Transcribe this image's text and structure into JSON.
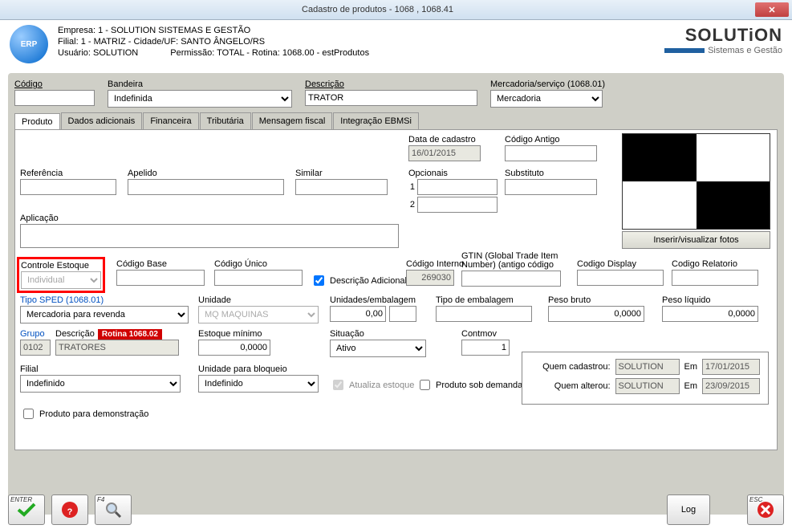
{
  "window": {
    "title": "Cadastro de produtos - 1068 , 1068.41"
  },
  "header": {
    "empresa": "Empresa: 1 - SOLUTION SISTEMAS E GESTÃO",
    "filial": "Filial: 1 - MATRIZ - Cidade/UF: SANTO ÂNGELO/RS",
    "usuario": "Usuário: SOLUTION",
    "permissao": "Permissão: TOTAL - Rotina: 1068.00 - estProdutos",
    "brand": "SOLUTiON",
    "brand_sub": "Sistemas e Gestão",
    "logo_text": "ERP"
  },
  "top_fields": {
    "codigo_lbl": "Código",
    "codigo": "",
    "bandeira_lbl": "Bandeira",
    "bandeira": "Indefinida",
    "descricao_lbl": "Descrição",
    "descricao": "TRATOR",
    "merc_lbl": "Mercadoria/serviço (1068.01)",
    "merc": "Mercadoria"
  },
  "tabs": {
    "produto": "Produto",
    "dados": "Dados adicionais",
    "financeira": "Financeira",
    "tributaria": "Tributária",
    "msg_fiscal": "Mensagem fiscal",
    "integracao": "Integração EBMSi"
  },
  "panel": {
    "data_cadastro_lbl": "Data de cadastro",
    "data_cadastro": "16/01/2015",
    "cod_antigo_lbl": "Código Antigo",
    "cod_antigo": "",
    "referencia_lbl": "Referência",
    "referencia": "",
    "apelido_lbl": "Apelido",
    "apelido": "",
    "similar_lbl": "Similar",
    "similar": "",
    "opcionais_lbl": "Opcionais",
    "opt1_n": "1",
    "opt1": "",
    "opt2_n": "2",
    "opt2": "",
    "substituto_lbl": "Substituto",
    "substituto": "",
    "aplicacao_lbl": "Aplicação",
    "aplicacao": "",
    "photo_btn": "Inserir/visualizar fotos",
    "controle_lbl": "Controle Estoque",
    "controle": "Individual",
    "cod_base_lbl": "Código Base",
    "cod_base": "",
    "cod_unico_lbl": "Código Único",
    "cod_unico": "",
    "desc_adicional_lbl": "Descrição Adicional",
    "cod_interno_lbl": "Código Interno",
    "cod_interno": "269030",
    "gtin_lbl": "GTIN (Global Trade Item Number) (antigo código",
    "gtin": "",
    "cod_display_lbl": "Codigo Display",
    "cod_display": "",
    "cod_relatorio_lbl": "Codigo Relatorio",
    "cod_relatorio": "",
    "tipo_sped_lbl": "Tipo SPED (1068.01)",
    "tipo_sped": "Mercadoria para revenda",
    "unidade_lbl": "Unidade",
    "unidade": "MQ  MAQUINAS",
    "unid_emb_lbl": "Unidades/embalagem",
    "unid_emb": "0,00",
    "unid_emb2": "",
    "tipo_emb_lbl": "Tipo de embalagem",
    "tipo_emb": "",
    "peso_bruto_lbl": "Peso bruto",
    "peso_bruto": "0,0000",
    "peso_liq_lbl": "Peso líquido",
    "peso_liq": "0,0000",
    "grupo_lbl": "Grupo",
    "grupo": "0102",
    "grupo_desc_lbl": "Descrição",
    "grupo_desc": "TRATORES",
    "rotina_badge": "Rotina 1068.02",
    "est_min_lbl": "Estoque mínimo",
    "est_min": "0,0000",
    "situacao_lbl": "Situação",
    "situacao": "Ativo",
    "contmov_lbl": "Contmov",
    "contmov": "1",
    "filial_lbl": "Filial",
    "filial": "Indefinido",
    "unid_bloq_lbl": "Unidade para bloqueio",
    "unid_bloq": "Indefinido",
    "atualiza_lbl": "Atualiza estoque",
    "sob_demanda_lbl": "Produto sob demanda",
    "demo_lbl": "Produto para demonstração",
    "audit": {
      "cad_lbl": "Quem cadastrou:",
      "cad_user": "SOLUTION",
      "cad_em": "Em",
      "cad_date": "17/01/2015",
      "alt_lbl": "Quem alterou:",
      "alt_user": "SOLUTION",
      "alt_em": "Em",
      "alt_date": "23/09/2015"
    }
  },
  "footer": {
    "enter_key": "ENTER",
    "f4_key": "F4",
    "esc_key": "ESC",
    "log": "Log"
  }
}
